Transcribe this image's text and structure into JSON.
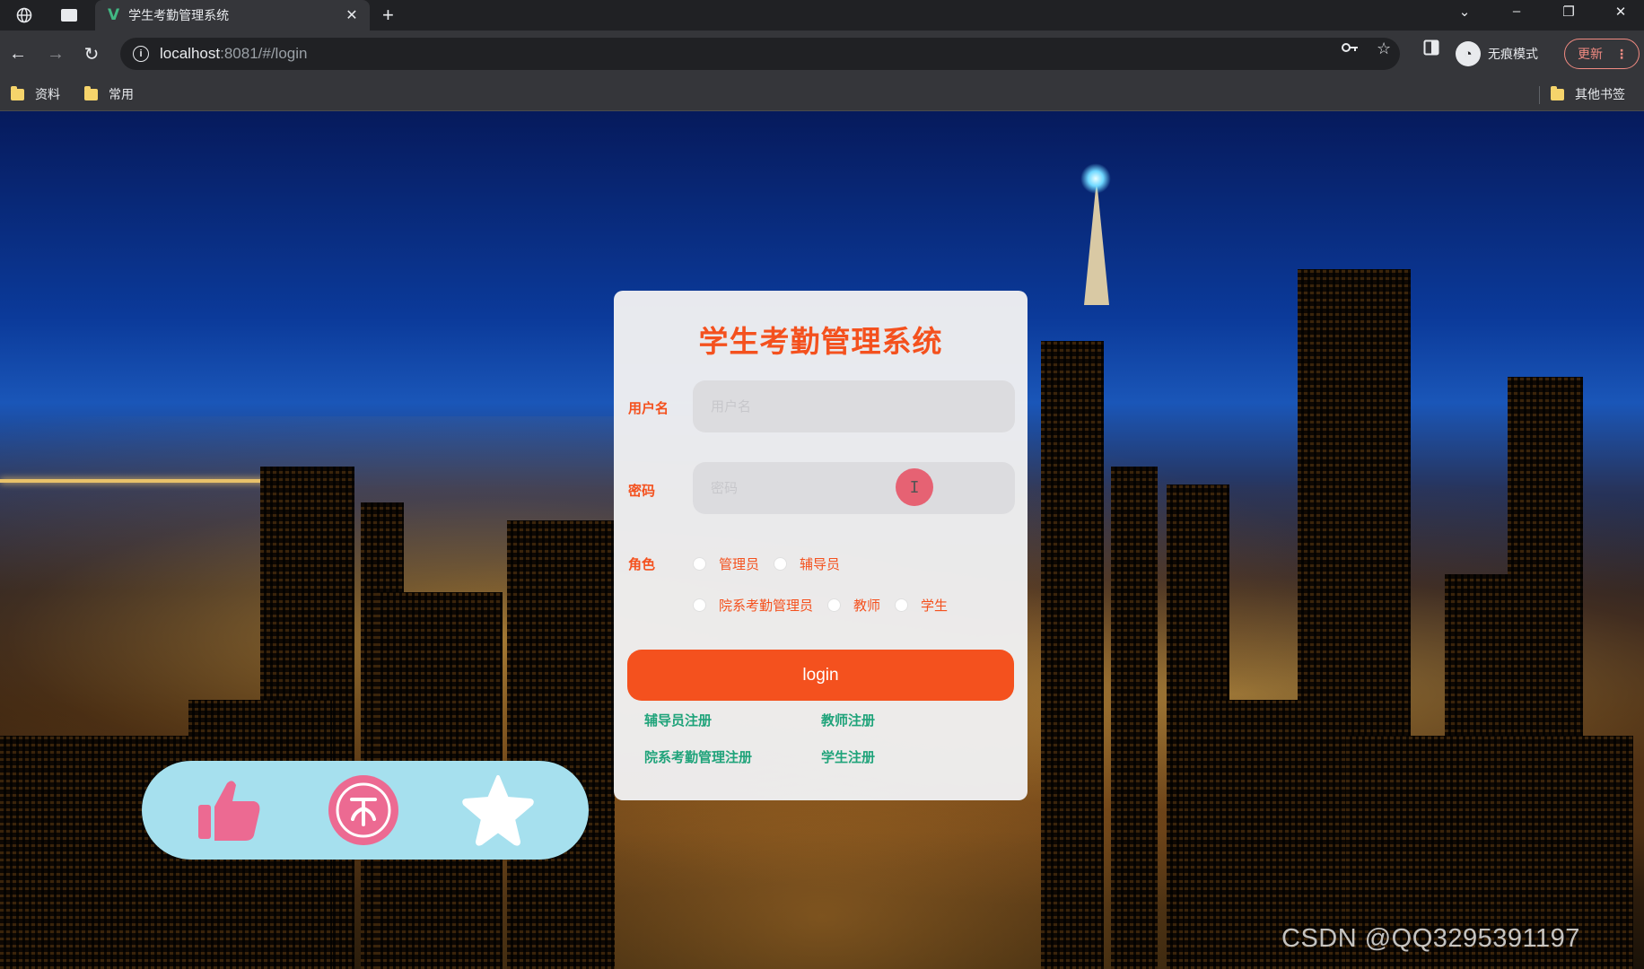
{
  "browser": {
    "tab_title": "学生考勤管理系统",
    "url_host": "localhost",
    "url_path": ":8081/#/login",
    "incognito_label": "无痕模式",
    "update_label": "更新",
    "bookmarks": [
      "资料",
      "常用"
    ],
    "other_bookmarks": "其他书签"
  },
  "login": {
    "title": "学生考勤管理系统",
    "username_label": "用户名",
    "username_placeholder": "用户名",
    "password_label": "密码",
    "password_placeholder": "密码",
    "role_label": "角色",
    "roles": [
      "管理员",
      "辅导员",
      "院系考勤管理员",
      "教师",
      "学生"
    ],
    "login_button": "login",
    "register_links": [
      "辅导员注册",
      "教师注册",
      "院系考勤管理注册",
      "学生注册"
    ]
  },
  "watermark": "CSDN @QQ3295391197",
  "colors": {
    "accent": "#f4511e",
    "link": "#1fa37a",
    "pill_bg": "#a6e0ee",
    "pill_icon": "#ec6a92"
  }
}
